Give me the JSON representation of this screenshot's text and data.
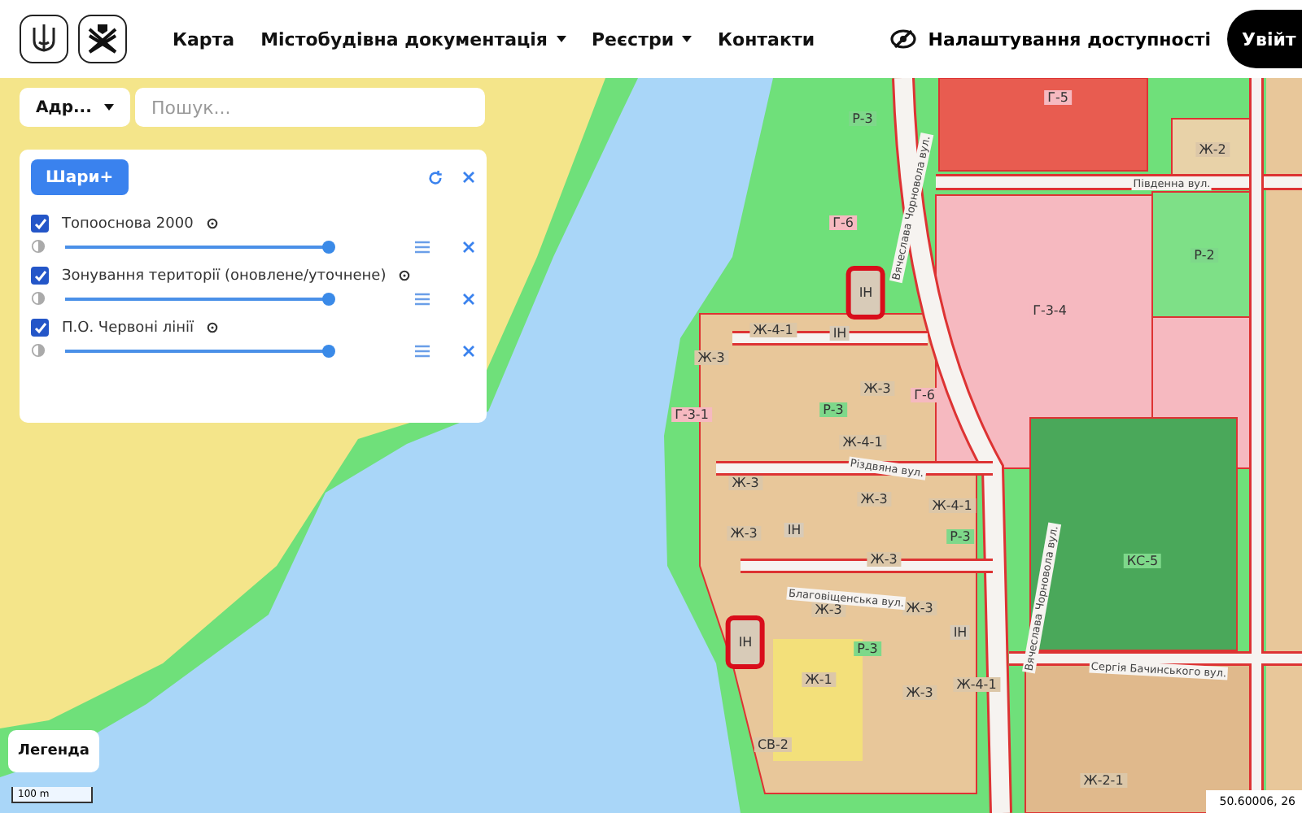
{
  "header": {
    "nav": [
      {
        "label": "Карта",
        "dropdown": false
      },
      {
        "label": "Містобудівна документація",
        "dropdown": true
      },
      {
        "label": "Реєстри",
        "dropdown": true
      },
      {
        "label": "Контакти",
        "dropdown": false
      }
    ],
    "accessibility": "Налаштування доступності",
    "login": "Увійт"
  },
  "search": {
    "type": "Адр...",
    "placeholder": "Пошук..."
  },
  "layers_panel": {
    "add_button": "Шари+",
    "layers": [
      {
        "label": "Топооснова 2000",
        "checked": true,
        "level": 1
      },
      {
        "label": "Зонування території (оновлене/уточнене)",
        "checked": true,
        "level": 1
      },
      {
        "label": "П.О. Червоні лінії",
        "checked": true,
        "level": 1
      }
    ]
  },
  "map": {
    "zones": [
      {
        "label": "Г-5",
        "kind": "public"
      },
      {
        "label": "Р-3",
        "kind": "green"
      },
      {
        "label": "Ж-2",
        "kind": "housing"
      },
      {
        "label": "Р-2",
        "kind": "green"
      },
      {
        "label": "Г-6",
        "kind": "public"
      },
      {
        "label": "ІН",
        "kind": "engineering",
        "highlighted": true
      },
      {
        "label": "Ж-4-1",
        "kind": "housing"
      },
      {
        "label": "ІН",
        "kind": "engineering",
        "highlighted": false
      },
      {
        "label": "Ж-3",
        "kind": "housing"
      },
      {
        "label": "Г-3-4",
        "kind": "public"
      },
      {
        "label": "Ж-3",
        "kind": "housing"
      },
      {
        "label": "Г-6",
        "kind": "public"
      },
      {
        "label": "Р-3",
        "kind": "green"
      },
      {
        "label": "Г-3-1",
        "kind": "public"
      },
      {
        "label": "Ж-4-1",
        "kind": "housing"
      },
      {
        "label": "Ж-3",
        "kind": "housing"
      },
      {
        "label": "Ж-3",
        "kind": "housing"
      },
      {
        "label": "Ж-4-1",
        "kind": "housing"
      },
      {
        "label": "Ж-3",
        "kind": "housing"
      },
      {
        "label": "ІН",
        "kind": "engineering",
        "highlighted": false
      },
      {
        "label": "Ж-3",
        "kind": "housing"
      },
      {
        "label": "Р-3",
        "kind": "green"
      },
      {
        "label": "КС-5",
        "kind": "green"
      },
      {
        "label": "Ж-3",
        "kind": "housing"
      },
      {
        "label": "Ж-3",
        "kind": "housing"
      },
      {
        "label": "ІН",
        "kind": "engineering",
        "highlighted": false
      },
      {
        "label": "ІН",
        "kind": "engineering",
        "highlighted": true
      },
      {
        "label": "Р-3",
        "kind": "green"
      },
      {
        "label": "Ж-1",
        "kind": "housing"
      },
      {
        "label": "Ж-3",
        "kind": "housing"
      },
      {
        "label": "Ж-4-1",
        "kind": "housing"
      },
      {
        "label": "СВ-2",
        "kind": "housing"
      },
      {
        "label": "Ж-2-1",
        "kind": "housing"
      }
    ],
    "streets": [
      "Вячеслава Чорновола вул.",
      "Південна вул.",
      "Різдвяна вул.",
      "Благовіщенська вул.",
      "Вячеслава Чорновола вул.",
      "Сергія Бачинського вул."
    ],
    "legend_button": "Легенда",
    "scale": "100 m",
    "coordinates": "50.60006, 26"
  }
}
